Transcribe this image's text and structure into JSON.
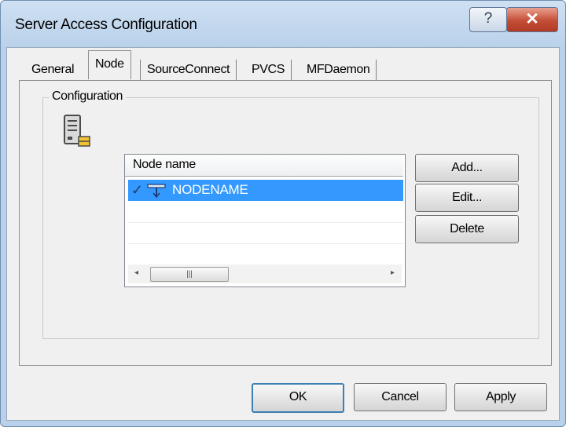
{
  "window": {
    "title": "Server Access Configuration",
    "help_glyph": "?",
    "close_glyph": "✕"
  },
  "tabs": [
    {
      "label": "General",
      "active": false
    },
    {
      "label": "Node",
      "active": true
    },
    {
      "label": "SourceConnect",
      "active": false
    },
    {
      "label": "PVCS",
      "active": false
    },
    {
      "label": "MFDaemon",
      "active": false
    }
  ],
  "configuration": {
    "group_label": "Configuration",
    "icon": "server-icon",
    "list": {
      "column_header": "Node name",
      "rows": [
        {
          "name": "NODENAME",
          "checked": true,
          "selected": true,
          "check_glyph": "✓"
        }
      ],
      "scrollbar": {
        "left_arrow": "◂",
        "right_arrow": "▸",
        "thumb_grip": "|||"
      }
    },
    "buttons": {
      "add": "Add...",
      "edit": "Edit...",
      "delete": "Delete"
    }
  },
  "footer": {
    "ok": "OK",
    "cancel": "Cancel",
    "apply": "Apply"
  },
  "colors": {
    "selection": "#3399ff",
    "title_gradient": "#b9d1ea",
    "close": "#c44d35"
  }
}
